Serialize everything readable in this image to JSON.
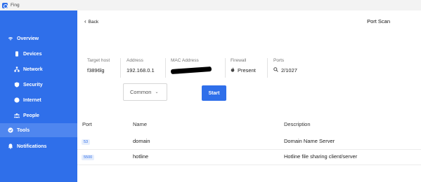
{
  "window": {
    "title": "Fing"
  },
  "sidebar": {
    "items": [
      {
        "label": "Overview",
        "icon": "wifi-icon"
      },
      {
        "label": "Devices",
        "icon": "device-icon"
      },
      {
        "label": "Network",
        "icon": "network-icon"
      },
      {
        "label": "Security",
        "icon": "shield-icon"
      },
      {
        "label": "Internet",
        "icon": "globe-icon"
      },
      {
        "label": "People",
        "icon": "people-icon"
      },
      {
        "label": "Tools",
        "icon": "tools-icon",
        "active": true
      },
      {
        "label": "Notifications",
        "icon": "bell-icon"
      }
    ]
  },
  "header": {
    "back_label": "Back",
    "title": "Port Scan"
  },
  "info": {
    "target_host": {
      "label": "Target host",
      "value": "f3896lg"
    },
    "address": {
      "label": "Address",
      "value": "192.168.0.1"
    },
    "mac_address": {
      "label": "MAC Address",
      "value": ""
    },
    "firewall": {
      "label": "Firewall",
      "value": "Present"
    },
    "ports": {
      "label": "Ports",
      "value": "2/1027"
    }
  },
  "controls": {
    "preset_value": "Common",
    "start_label": "Start"
  },
  "table": {
    "columns": [
      "Port",
      "Name",
      "Description"
    ],
    "rows": [
      {
        "port": "53",
        "name": "domain",
        "description": "Domain Name Server"
      },
      {
        "port": "5500",
        "name": "hotline",
        "description": "Hotline file sharing client/server"
      }
    ]
  },
  "colors": {
    "accent": "#2f6fea",
    "sidebar_active": "#4f86ef"
  }
}
